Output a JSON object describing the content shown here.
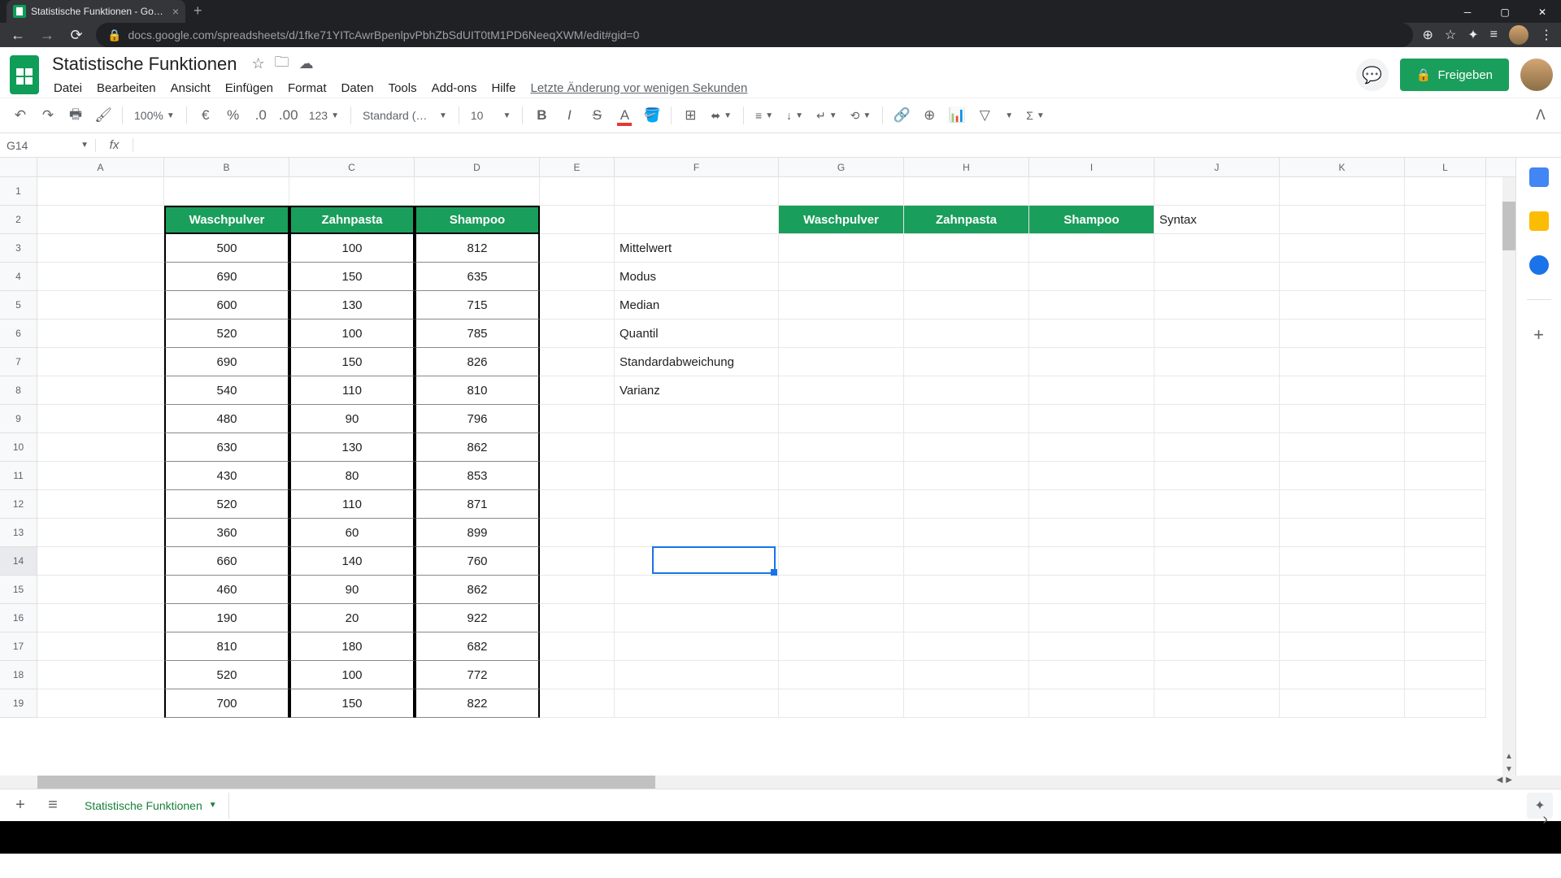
{
  "browser": {
    "tab_title": "Statistische Funktionen - Google",
    "url": "docs.google.com/spreadsheets/d/1fke71YITcAwrBpenlpvPbhZbSdUIT0tM1PD6NeeqXWM/edit#gid=0"
  },
  "doc": {
    "title": "Statistische Funktionen",
    "last_edit": "Letzte Änderung vor wenigen Sekunden"
  },
  "menus": [
    "Datei",
    "Bearbeiten",
    "Ansicht",
    "Einfügen",
    "Format",
    "Daten",
    "Tools",
    "Add-ons",
    "Hilfe"
  ],
  "share_label": "Freigeben",
  "toolbar": {
    "zoom": "100%",
    "number_format": "123",
    "font": "Standard (…",
    "font_size": "10"
  },
  "name_box": "G14",
  "columns": [
    "A",
    "B",
    "C",
    "D",
    "E",
    "F",
    "G",
    "H",
    "I",
    "J",
    "K",
    "L"
  ],
  "rows_visible": 19,
  "headers_left": {
    "b": "Waschpulver",
    "c": "Zahnpasta",
    "d": "Shampoo"
  },
  "headers_right": {
    "g": "Waschpulver",
    "h": "Zahnpasta",
    "i": "Shampoo",
    "j": "Syntax"
  },
  "stat_labels": [
    "Mittelwert",
    "Modus",
    "Median",
    "Quantil",
    "Standardabweichung",
    "Varianz"
  ],
  "data_rows": [
    {
      "b": "500",
      "c": "100",
      "d": "812"
    },
    {
      "b": "690",
      "c": "150",
      "d": "635"
    },
    {
      "b": "600",
      "c": "130",
      "d": "715"
    },
    {
      "b": "520",
      "c": "100",
      "d": "785"
    },
    {
      "b": "690",
      "c": "150",
      "d": "826"
    },
    {
      "b": "540",
      "c": "110",
      "d": "810"
    },
    {
      "b": "480",
      "c": "90",
      "d": "796"
    },
    {
      "b": "630",
      "c": "130",
      "d": "862"
    },
    {
      "b": "430",
      "c": "80",
      "d": "853"
    },
    {
      "b": "520",
      "c": "110",
      "d": "871"
    },
    {
      "b": "360",
      "c": "60",
      "d": "899"
    },
    {
      "b": "660",
      "c": "140",
      "d": "760"
    },
    {
      "b": "460",
      "c": "90",
      "d": "862"
    },
    {
      "b": "190",
      "c": "20",
      "d": "922"
    },
    {
      "b": "810",
      "c": "180",
      "d": "682"
    },
    {
      "b": "520",
      "c": "100",
      "d": "772"
    },
    {
      "b": "700",
      "c": "150",
      "d": "822"
    }
  ],
  "sheet_tab": "Statistische Funktionen",
  "selected_cell": "G14",
  "colors": {
    "accent_green": "#1a9e5c",
    "share_green": "#1a9e5c",
    "selection_blue": "#1a73e8"
  }
}
